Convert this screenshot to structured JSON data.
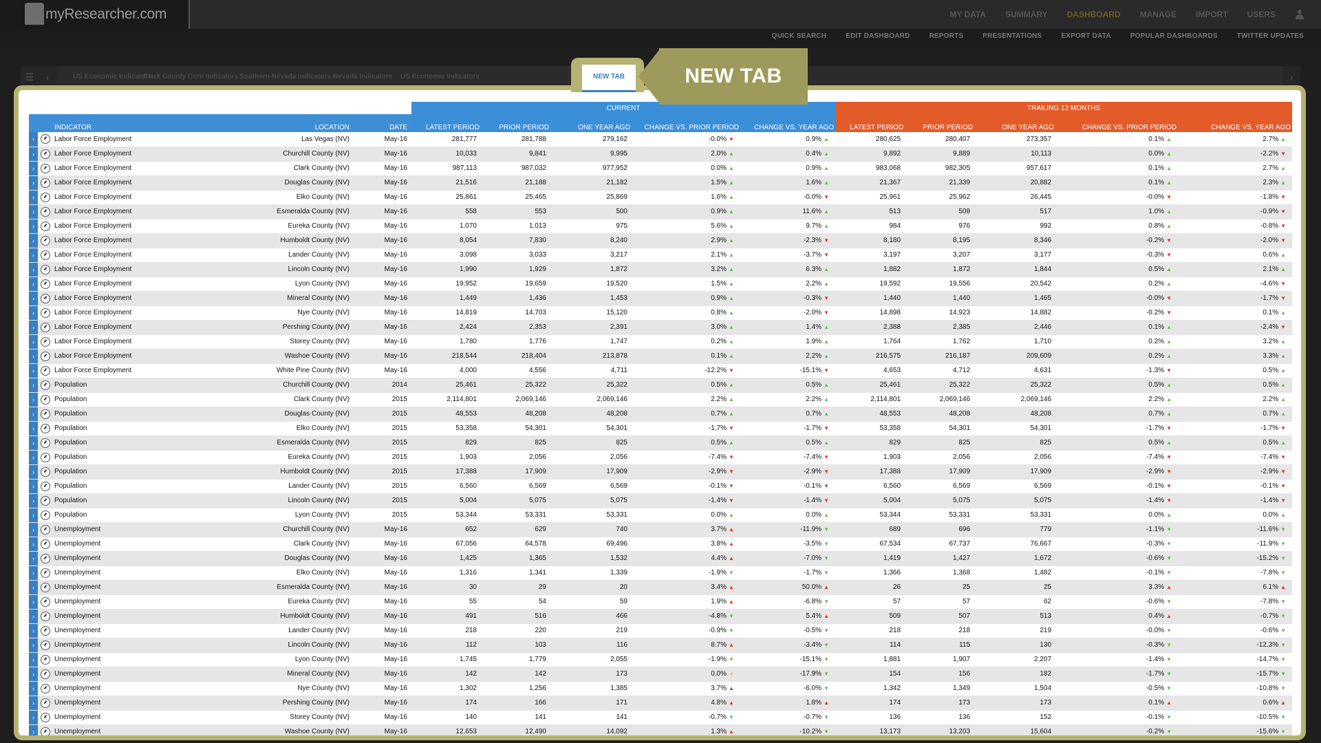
{
  "app": {
    "logo_text": "myResearcher.com"
  },
  "main_nav": [
    {
      "label": "MY DATA",
      "active": false
    },
    {
      "label": "SUMMARY",
      "active": false
    },
    {
      "label": "DASHBOARD",
      "active": true
    },
    {
      "label": "MANAGE",
      "active": false
    },
    {
      "label": "IMPORT",
      "active": false
    },
    {
      "label": "USERS",
      "active": false
    }
  ],
  "sub_nav": [
    "QUICK SEARCH",
    "EDIT DASHBOARD",
    "REPORTS",
    "PRESENTATIONS",
    "EXPORT DATA",
    "POPULAR DASHBOARDS",
    "TWITTER UPDATES"
  ],
  "tabs": [
    "US Economic Indicators",
    "Clark County Core Indicators",
    "Southern Nevada Indicators",
    "Nevada Indicators",
    "US Economic Indicators"
  ],
  "new_tab_label": "NEW TAB",
  "callout_text": "NEW TAB",
  "table": {
    "group_current": "CURRENT",
    "group_trailing": "TRAILING 12 MONTHS",
    "col_indicator": "INDICATOR",
    "col_location": "LOCATION",
    "col_date": "DATE",
    "col_latest": "LATEST PERIOD",
    "col_prior": "PRIOR PERIOD",
    "col_yearago": "ONE YEAR AGO",
    "col_chg_prior": "CHANGE VS. PRIOR PERIOD",
    "col_chg_year": "CHANGE VS. YEAR AGO",
    "rows": [
      [
        "Labor Force Employment",
        "Las Vegas (NV)",
        "May-16",
        "281,777",
        "281,788",
        "279,162",
        "-0.0%",
        "dn",
        "0.9%",
        "up",
        "280,625",
        "280,407",
        "273,357",
        "0.1%",
        "up",
        "2.7%",
        "up"
      ],
      [
        "Labor Force Employment",
        "Churchill County (NV)",
        "May-16",
        "10,033",
        "9,841",
        "9,995",
        "2.0%",
        "up",
        "0.4%",
        "up",
        "9,892",
        "9,889",
        "10,113",
        "0.0%",
        "up",
        "-2.2%",
        "dn"
      ],
      [
        "Labor Force Employment",
        "Clark County (NV)",
        "May-16",
        "987,113",
        "987,032",
        "977,952",
        "0.0%",
        "up",
        "0.9%",
        "up",
        "983,068",
        "982,305",
        "957,617",
        "0.1%",
        "up",
        "2.7%",
        "up"
      ],
      [
        "Labor Force Employment",
        "Douglas County (NV)",
        "May-16",
        "21,516",
        "21,188",
        "21,182",
        "1.5%",
        "up",
        "1.6%",
        "up",
        "21,367",
        "21,339",
        "20,882",
        "0.1%",
        "up",
        "2.3%",
        "up"
      ],
      [
        "Labor Force Employment",
        "Elko County (NV)",
        "May-16",
        "25,861",
        "25,465",
        "25,869",
        "1.6%",
        "up",
        "-0.0%",
        "dn",
        "25,961",
        "25,962",
        "26,445",
        "-0.0%",
        "dn",
        "-1.8%",
        "dn"
      ],
      [
        "Labor Force Employment",
        "Esmeralda County (NV)",
        "May-16",
        "558",
        "553",
        "500",
        "0.9%",
        "up",
        "11.6%",
        "up",
        "513",
        "508",
        "517",
        "1.0%",
        "up",
        "-0.9%",
        "dn"
      ],
      [
        "Labor Force Employment",
        "Eureka County (NV)",
        "May-16",
        "1,070",
        "1,013",
        "975",
        "5.6%",
        "up",
        "9.7%",
        "up",
        "984",
        "976",
        "992",
        "0.8%",
        "up",
        "-0.8%",
        "dn"
      ],
      [
        "Labor Force Employment",
        "Humboldt County (NV)",
        "May-16",
        "8,054",
        "7,830",
        "8,240",
        "2.9%",
        "up",
        "-2.3%",
        "dn",
        "8,180",
        "8,195",
        "8,346",
        "-0.2%",
        "dn",
        "-2.0%",
        "dn"
      ],
      [
        "Labor Force Employment",
        "Lander County (NV)",
        "May-16",
        "3,098",
        "3,033",
        "3,217",
        "2.1%",
        "up",
        "-3.7%",
        "dn",
        "3,197",
        "3,207",
        "3,177",
        "-0.3%",
        "dn",
        "0.6%",
        "up"
      ],
      [
        "Labor Force Employment",
        "Lincoln County (NV)",
        "May-16",
        "1,990",
        "1,929",
        "1,872",
        "3.2%",
        "up",
        "6.3%",
        "up",
        "1,882",
        "1,872",
        "1,844",
        "0.5%",
        "up",
        "2.1%",
        "up"
      ],
      [
        "Labor Force Employment",
        "Lyon County (NV)",
        "May-16",
        "19,952",
        "19,659",
        "19,520",
        "1.5%",
        "up",
        "2.2%",
        "up",
        "19,592",
        "19,556",
        "20,542",
        "0.2%",
        "up",
        "-4.6%",
        "dn"
      ],
      [
        "Labor Force Employment",
        "Mineral County (NV)",
        "May-16",
        "1,449",
        "1,436",
        "1,453",
        "0.9%",
        "up",
        "-0.3%",
        "dn",
        "1,440",
        "1,440",
        "1,465",
        "-0.0%",
        "dn",
        "-1.7%",
        "dn"
      ],
      [
        "Labor Force Employment",
        "Nye County (NV)",
        "May-16",
        "14,819",
        "14,703",
        "15,120",
        "0.8%",
        "up",
        "-2.0%",
        "dn",
        "14,898",
        "14,923",
        "14,882",
        "-0.2%",
        "dn",
        "0.1%",
        "up"
      ],
      [
        "Labor Force Employment",
        "Pershing County (NV)",
        "May-16",
        "2,424",
        "2,353",
        "2,391",
        "3.0%",
        "up",
        "1.4%",
        "up",
        "2,388",
        "2,385",
        "2,446",
        "0.1%",
        "up",
        "-2.4%",
        "dn"
      ],
      [
        "Labor Force Employment",
        "Storey County (NV)",
        "May-16",
        "1,780",
        "1,776",
        "1,747",
        "0.2%",
        "up",
        "1.9%",
        "up",
        "1,764",
        "1,762",
        "1,710",
        "0.2%",
        "up",
        "3.2%",
        "up"
      ],
      [
        "Labor Force Employment",
        "Washoe County (NV)",
        "May-16",
        "218,544",
        "218,404",
        "213,878",
        "0.1%",
        "up",
        "2.2%",
        "up",
        "216,575",
        "216,187",
        "209,609",
        "0.2%",
        "up",
        "3.3%",
        "up"
      ],
      [
        "Labor Force Employment",
        "White Pine County (NV)",
        "May-16",
        "4,000",
        "4,556",
        "4,711",
        "-12.2%",
        "dn",
        "-15.1%",
        "dn",
        "4,653",
        "4,712",
        "4,631",
        "-1.3%",
        "dn",
        "0.5%",
        "up"
      ],
      [
        "Population",
        "Churchill County (NV)",
        "2014",
        "25,461",
        "25,322",
        "25,322",
        "0.5%",
        "up",
        "0.5%",
        "up",
        "25,461",
        "25,322",
        "25,322",
        "0.5%",
        "up",
        "0.5%",
        "up"
      ],
      [
        "Population",
        "Clark County (NV)",
        "2015",
        "2,114,801",
        "2,069,146",
        "2,069,146",
        "2.2%",
        "up",
        "2.2%",
        "up",
        "2,114,801",
        "2,069,146",
        "2,069,146",
        "2.2%",
        "up",
        "2.2%",
        "up"
      ],
      [
        "Population",
        "Douglas County (NV)",
        "2015",
        "48,553",
        "48,208",
        "48,208",
        "0.7%",
        "up",
        "0.7%",
        "up",
        "48,553",
        "48,208",
        "48,208",
        "0.7%",
        "up",
        "0.7%",
        "up"
      ],
      [
        "Population",
        "Elko County (NV)",
        "2015",
        "53,358",
        "54,301",
        "54,301",
        "-1.7%",
        "dn",
        "-1.7%",
        "dn",
        "53,358",
        "54,301",
        "54,301",
        "-1.7%",
        "dn",
        "-1.7%",
        "dn"
      ],
      [
        "Population",
        "Esmeralda County (NV)",
        "2015",
        "829",
        "825",
        "825",
        "0.5%",
        "up",
        "0.5%",
        "up",
        "829",
        "825",
        "825",
        "0.5%",
        "up",
        "0.5%",
        "up"
      ],
      [
        "Population",
        "Eureka County (NV)",
        "2015",
        "1,903",
        "2,056",
        "2,056",
        "-7.4%",
        "dn",
        "-7.4%",
        "dn",
        "1,903",
        "2,056",
        "2,056",
        "-7.4%",
        "dn",
        "-7.4%",
        "dn"
      ],
      [
        "Population",
        "Humboldt County (NV)",
        "2015",
        "17,388",
        "17,909",
        "17,909",
        "-2.9%",
        "dn",
        "-2.9%",
        "dn",
        "17,388",
        "17,909",
        "17,909",
        "-2.9%",
        "dn",
        "-2.9%",
        "dn"
      ],
      [
        "Population",
        "Lander County (NV)",
        "2015",
        "6,560",
        "6,569",
        "6,569",
        "-0.1%",
        "dn",
        "-0.1%",
        "dn",
        "6,560",
        "6,569",
        "6,569",
        "-0.1%",
        "dn",
        "-0.1%",
        "dn"
      ],
      [
        "Population",
        "Lincoln County (NV)",
        "2015",
        "5,004",
        "5,075",
        "5,075",
        "-1.4%",
        "dn",
        "-1.4%",
        "dn",
        "5,004",
        "5,075",
        "5,075",
        "-1.4%",
        "dn",
        "-1.4%",
        "dn"
      ],
      [
        "Population",
        "Lyon County (NV)",
        "2015",
        "53,344",
        "53,331",
        "53,331",
        "0.0%",
        "up",
        "0.0%",
        "up",
        "53,344",
        "53,331",
        "53,331",
        "0.0%",
        "up",
        "0.0%",
        "up"
      ],
      [
        "Unemployment",
        "Churchill County (NV)",
        "May-16",
        "652",
        "629",
        "740",
        "3.7%",
        "upr",
        "-11.9%",
        "dng",
        "689",
        "696",
        "779",
        "-1.1%",
        "dng",
        "-11.6%",
        "dng"
      ],
      [
        "Unemployment",
        "Clark County (NV)",
        "May-16",
        "67,056",
        "64,578",
        "69,496",
        "3.8%",
        "upr",
        "-3.5%",
        "dng",
        "67,534",
        "67,737",
        "76,667",
        "-0.3%",
        "dng",
        "-11.9%",
        "dng"
      ],
      [
        "Unemployment",
        "Douglas County (NV)",
        "May-16",
        "1,425",
        "1,365",
        "1,532",
        "4.4%",
        "upr",
        "-7.0%",
        "dng",
        "1,419",
        "1,427",
        "1,672",
        "-0.6%",
        "dng",
        "-15.2%",
        "dng"
      ],
      [
        "Unemployment",
        "Elko County (NV)",
        "May-16",
        "1,316",
        "1,341",
        "1,339",
        "-1.9%",
        "dng",
        "-1.7%",
        "dng",
        "1,366",
        "1,368",
        "1,482",
        "-0.1%",
        "dng",
        "-7.8%",
        "dng"
      ],
      [
        "Unemployment",
        "Esmeralda County (NV)",
        "May-16",
        "30",
        "29",
        "20",
        "3.4%",
        "upr",
        "50.0%",
        "upr",
        "26",
        "25",
        "25",
        "3.3%",
        "upr",
        "6.1%",
        "upr"
      ],
      [
        "Unemployment",
        "Eureka County (NV)",
        "May-16",
        "55",
        "54",
        "59",
        "1.9%",
        "upr",
        "-6.8%",
        "dng",
        "57",
        "57",
        "62",
        "-0.6%",
        "dng",
        "-7.8%",
        "dng"
      ],
      [
        "Unemployment",
        "Humboldt County (NV)",
        "May-16",
        "491",
        "516",
        "466",
        "-4.8%",
        "dng",
        "5.4%",
        "upr",
        "509",
        "507",
        "513",
        "0.4%",
        "upr",
        "-0.7%",
        "dng"
      ],
      [
        "Unemployment",
        "Lander County (NV)",
        "May-16",
        "218",
        "220",
        "219",
        "-0.9%",
        "dng",
        "-0.5%",
        "dng",
        "218",
        "218",
        "219",
        "-0.0%",
        "dng",
        "-0.6%",
        "dng"
      ],
      [
        "Unemployment",
        "Lincoln County (NV)",
        "May-16",
        "112",
        "103",
        "116",
        "8.7%",
        "upr",
        "-3.4%",
        "dng",
        "114",
        "115",
        "130",
        "-0.3%",
        "dng",
        "-12.3%",
        "dng"
      ],
      [
        "Unemployment",
        "Lyon County (NV)",
        "May-16",
        "1,745",
        "1,779",
        "2,055",
        "-1.9%",
        "dng",
        "-15.1%",
        "dng",
        "1,881",
        "1,907",
        "2,207",
        "-1.4%",
        "dng",
        "-14.7%",
        "dng"
      ],
      [
        "Unemployment",
        "Mineral County (NV)",
        "May-16",
        "142",
        "142",
        "173",
        "0.0%",
        "flat",
        "-17.9%",
        "dng",
        "154",
        "156",
        "182",
        "-1.7%",
        "dng",
        "-15.7%",
        "dng"
      ],
      [
        "Unemployment",
        "Nye County (NV)",
        "May-16",
        "1,302",
        "1,256",
        "1,385",
        "3.7%",
        "upr",
        "-6.0%",
        "dng",
        "1,342",
        "1,349",
        "1,504",
        "-0.5%",
        "dng",
        "-10.8%",
        "dng"
      ],
      [
        "Unemployment",
        "Pershing County (NV)",
        "May-16",
        "174",
        "166",
        "171",
        "4.8%",
        "upr",
        "1.8%",
        "upr",
        "174",
        "173",
        "173",
        "0.1%",
        "upr",
        "0.6%",
        "upr"
      ],
      [
        "Unemployment",
        "Storey County (NV)",
        "May-16",
        "140",
        "141",
        "141",
        "-0.7%",
        "dng",
        "-0.7%",
        "dng",
        "136",
        "136",
        "152",
        "-0.1%",
        "dng",
        "-10.5%",
        "dng"
      ],
      [
        "Unemployment",
        "Washoe County (NV)",
        "May-16",
        "12,653",
        "12,490",
        "14,092",
        "1.3%",
        "upr",
        "-10.2%",
        "dng",
        "13,173",
        "13,203",
        "15,604",
        "-0.2%",
        "dng",
        "-15.6%",
        "dng"
      ]
    ]
  }
}
